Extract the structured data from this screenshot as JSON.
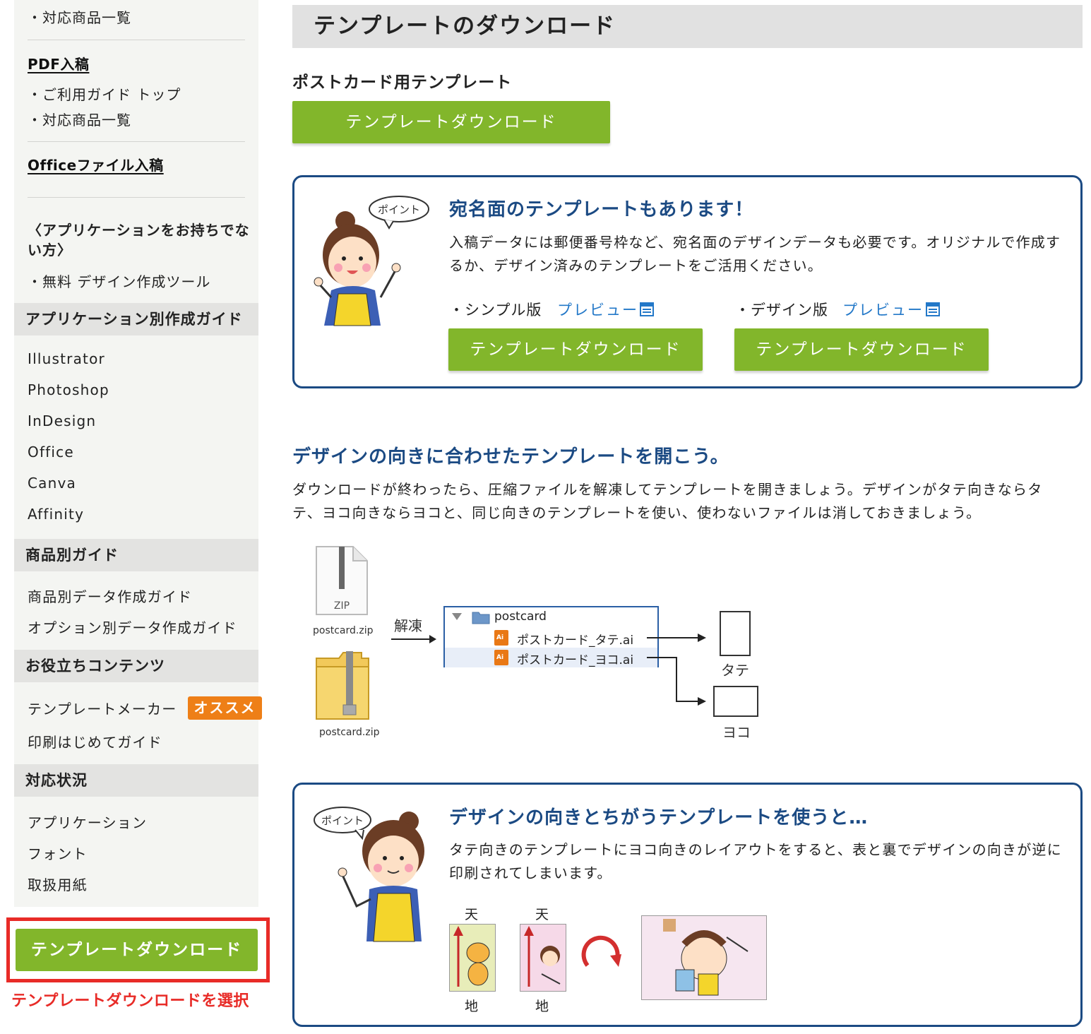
{
  "sidebar": {
    "top_item": "・対応商品一覧",
    "pdf_link": "PDF入稿",
    "pdf_items": [
      "・ご利用ガイド トップ",
      "・対応商品一覧"
    ],
    "office_link": "Officeファイル入稿",
    "no_app_note": "〈アプリケーションをお持ちでない方〉",
    "free_tool": "・無料 デザイン作成ツール",
    "sections": [
      {
        "title": "アプリケーション別作成ガイド",
        "items": [
          "Illustrator",
          "Photoshop",
          "InDesign",
          "Office",
          "Canva",
          "Affinity"
        ]
      },
      {
        "title": "商品別ガイド",
        "items": [
          "商品別データ作成ガイド",
          "オプション別データ作成ガイド"
        ]
      },
      {
        "title": "お役立ちコンテンツ",
        "items": [
          "テンプレートメーカー",
          "印刷はじめてガイド"
        ]
      },
      {
        "title": "対応状況",
        "items": [
          "アプリケーション",
          "フォント",
          "取扱用紙"
        ]
      }
    ],
    "recommend_badge": "オススメ",
    "download_button": "テンプレートダウンロード",
    "download_caption": "テンプレートダウンロードを選択"
  },
  "main": {
    "page_title": "テンプレートのダウンロード",
    "postcard_heading": "ポストカード用テンプレート",
    "postcard_download": "テンプレートダウンロード",
    "address_box": {
      "bubble": "ポイント",
      "title": "宛名面のテンプレートもあります！",
      "text": "入稿データには郵便番号枠など、宛名面のデザインデータも必要です。オリジナルで作成するか、デザイン済みのテンプレートをご活用ください。",
      "simple_label": "・シンプル版",
      "design_label": "・デザイン版",
      "preview": "プレビュー",
      "download": "テンプレートダウンロード"
    },
    "orientation": {
      "heading": "デザインの向きに合わせたテンプレートを開こう。",
      "text": "ダウンロードが終わったら、圧縮ファイルを解凍してテンプレートを開きましょう。デザインがタテ向きならタテ、ヨコ向きならヨコと、同じ向きのテンプレートを使い、使わないファイルは消しておきましょう。",
      "zip_label": "ZIP",
      "zip_file": "postcard.zip",
      "unzip": "解凍",
      "folder": "postcard",
      "file_tate": "ポストカード_タテ.ai",
      "file_yoko": "ポストカード_ヨコ.ai",
      "ai_badge": "Ai",
      "tate": "タテ",
      "yoko": "ヨコ"
    },
    "warning_box": {
      "bubble": "ポイント",
      "title": "デザインの向きとちがうテンプレートを使うと…",
      "text": "タテ向きのテンプレートにヨコ向きのレイアウトをすると、表と裏でデザインの向きが逆に印刷されてしまいます。",
      "ten": "天",
      "chi": "地"
    }
  },
  "colors": {
    "green": "#82b62b",
    "navy": "#1b4a83",
    "link_blue": "#2378c8",
    "orange": "#ee7f17",
    "red": "#e82b27",
    "sidebar_bg": "#f4f5f2"
  }
}
